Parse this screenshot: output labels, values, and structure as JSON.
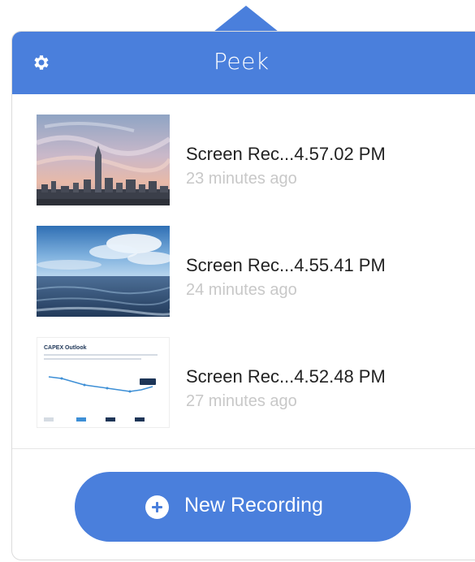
{
  "header": {
    "title": "Peek",
    "settings_icon": "gear-icon",
    "accent_color": "#4a7fdc"
  },
  "recordings": [
    {
      "name": "Screen Rec...4.57.02 PM",
      "time": "23 minutes ago",
      "thumbnail": "city-skyline-at-sunset"
    },
    {
      "name": "Screen Rec...4.55.41 PM",
      "time": "24 minutes ago",
      "thumbnail": "ocean-and-sky"
    },
    {
      "name": "Screen Rec...4.52.48 PM",
      "time": "27 minutes ago",
      "thumbnail": "capex-outlook-chart-slide",
      "thumbnail_title": "CAPEX Outlook"
    }
  ],
  "new_recording": {
    "label": "New Recording",
    "icon": "plus-circle-icon"
  }
}
